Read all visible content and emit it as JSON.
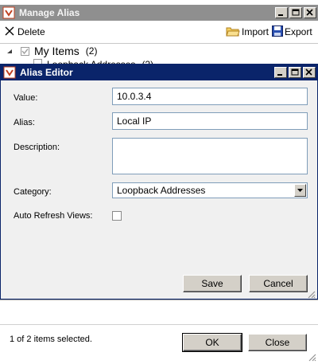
{
  "outer": {
    "title": "Manage Alias",
    "toolbar": {
      "delete_label": "Delete",
      "import_label": "Import",
      "export_label": "Export"
    },
    "tree": {
      "root_label": "My Items",
      "root_count": "(2)",
      "child_label": "Loopback Addresses",
      "child_count": "(2)"
    },
    "status": "1 of 2 items selected.",
    "ok_label": "OK",
    "close_label": "Close"
  },
  "editor": {
    "title": "Alias Editor",
    "value_label": "Value:",
    "value": "10.0.3.4",
    "alias_label": "Alias:",
    "alias": "Local IP",
    "description_label": "Description:",
    "description": "",
    "category_label": "Category:",
    "category": "Loopback Addresses",
    "auto_refresh_label": "Auto Refresh Views:",
    "auto_refresh_checked": false,
    "save_label": "Save",
    "cancel_label": "Cancel"
  },
  "colors": {
    "active_title": "#0a246a",
    "inactive_title": "#8f8f8f",
    "dialog_bg": "#f0f0f0",
    "button_face": "#d4d0c8"
  }
}
